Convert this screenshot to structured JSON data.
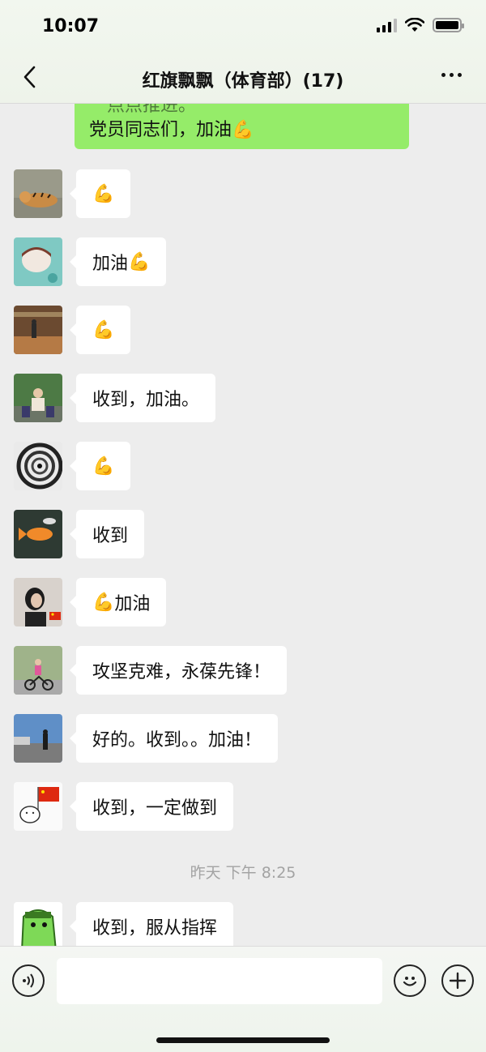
{
  "status": {
    "time": "10:07"
  },
  "header": {
    "title": "红旗飘飘（体育部）(17)",
    "back_icon": "chevron-left-icon",
    "more_icon": "more-dots-icon"
  },
  "my_message": {
    "faded_line": "点点推进。",
    "text": "党员同志们，加油",
    "emoji": "💪"
  },
  "messages": [
    {
      "text": "",
      "emoji_before": "💪",
      "avatar": "tiger"
    },
    {
      "text": "加油",
      "emoji_after": "💪",
      "avatar": "cartoon"
    },
    {
      "text": "",
      "emoji_before": "💪",
      "avatar": "gym"
    },
    {
      "text": "收到，加油。",
      "avatar": "family"
    },
    {
      "text": "",
      "emoji_before": "💪",
      "avatar": "spiral"
    },
    {
      "text": "收到",
      "avatar": "fish"
    },
    {
      "text": "加油",
      "emoji_before": "💪",
      "avatar": "woman"
    },
    {
      "text": "攻坚克难，永葆先锋！",
      "avatar": "bike"
    },
    {
      "text": "好的。收到。。加油！",
      "avatar": "street"
    },
    {
      "text": "收到，一定做到",
      "avatar": "flag-cartoon"
    },
    {
      "text": "收到，服从指挥",
      "avatar": "green-monster"
    }
  ],
  "timestamp": "昨天 下午 8:25",
  "input_bar": {
    "placeholder": "",
    "voice_icon": "voice-icon",
    "emoji_icon": "emoji-icon",
    "plus_icon": "plus-icon"
  },
  "colors": {
    "my_bubble": "#95ec69",
    "background": "#ededed",
    "timestamp": "#a3a3a3"
  }
}
